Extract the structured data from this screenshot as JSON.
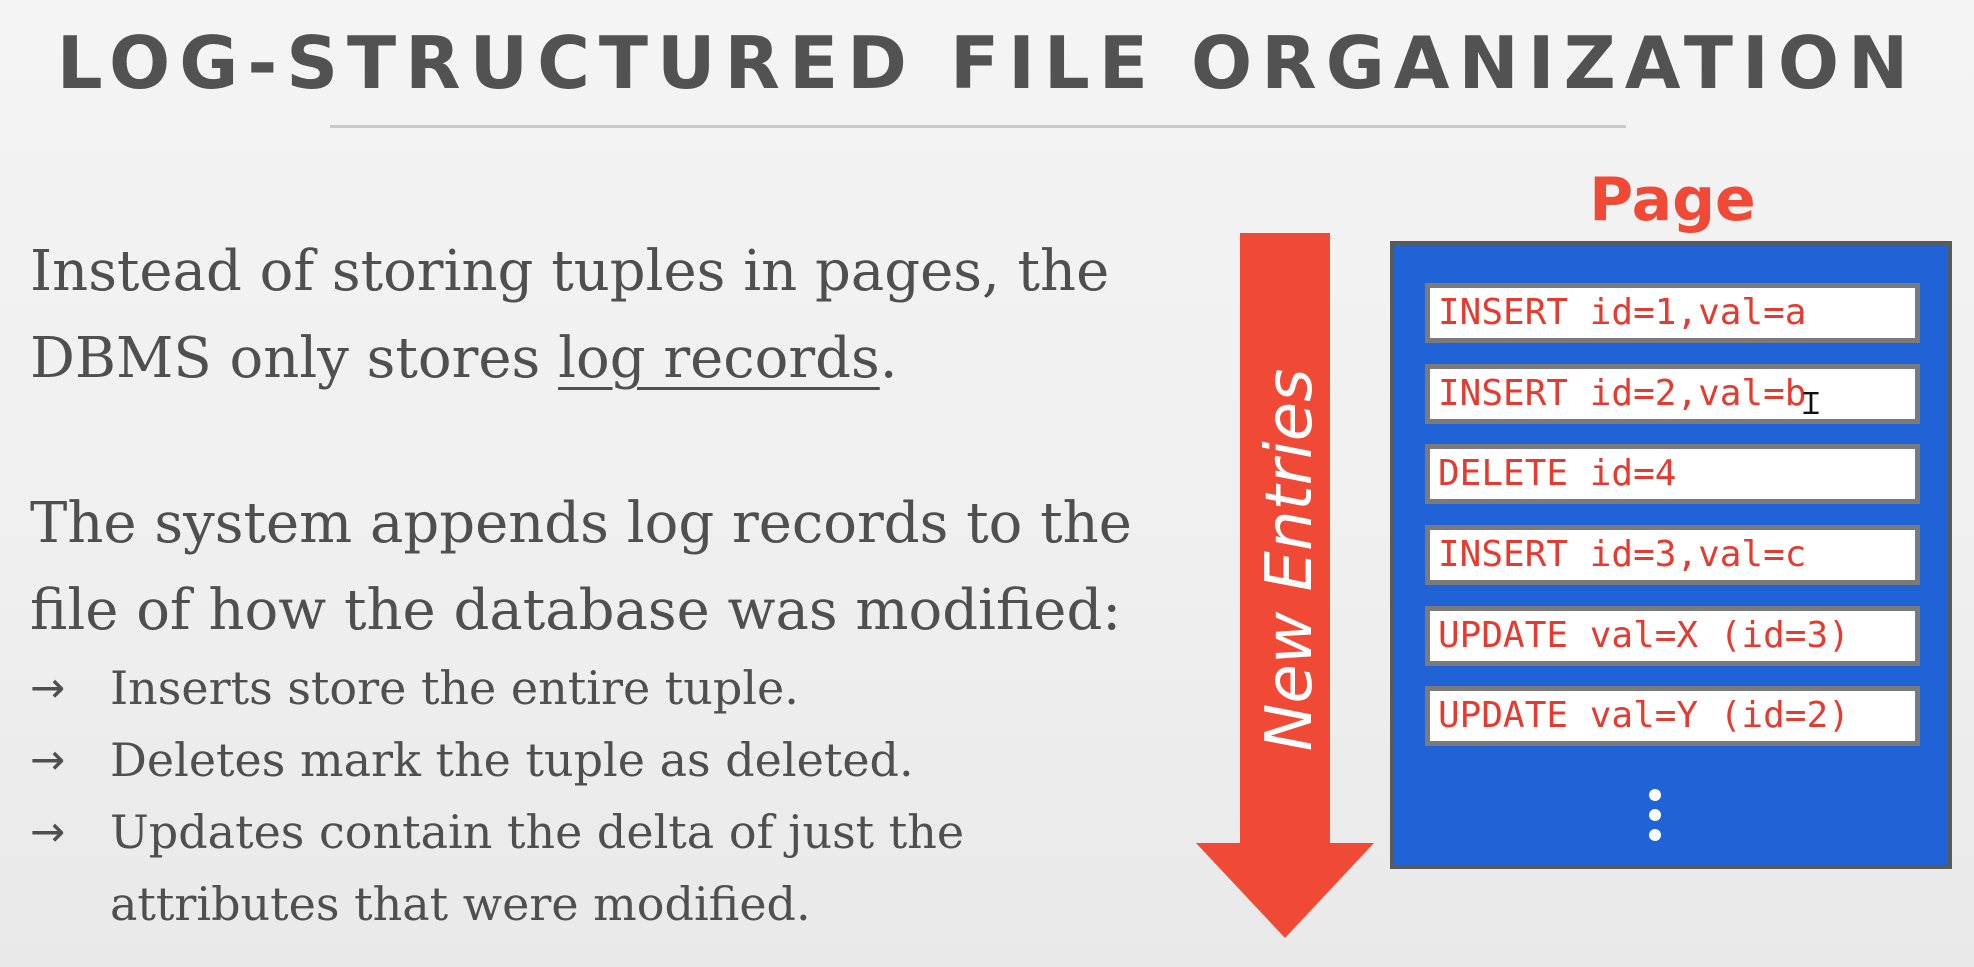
{
  "slide": {
    "title": "LOG-STRUCTURED FILE ORGANIZATION",
    "paragraph1": {
      "before": "Instead of storing tuples in pages, the DBMS only stores ",
      "underlined": "log records",
      "after": "."
    },
    "paragraph2": "The system appends log records to the file of how the database was modified:",
    "bullets": [
      "Inserts store the entire tuple.",
      "Deletes mark the tuple as deleted.",
      "Updates contain the delta of just the attributes that were modified."
    ],
    "bullet_arrow": "→"
  },
  "diagram": {
    "arrow_label": "New Entries",
    "page_label": "Page",
    "records": [
      "INSERT id=1,val=a",
      "INSERT id=2,val=b",
      "DELETE id=4",
      "INSERT id=3,val=c",
      "UPDATE val=X (id=3)",
      "UPDATE val=Y (id=2)"
    ],
    "colors": {
      "accent_red": "#f04a36",
      "page_blue": "#1f63d6",
      "text_gray": "#4f4f4f"
    }
  },
  "icons": {
    "cursor": "text-cursor-icon",
    "more": "vertical-ellipsis-icon",
    "arrow": "down-arrow-icon"
  }
}
